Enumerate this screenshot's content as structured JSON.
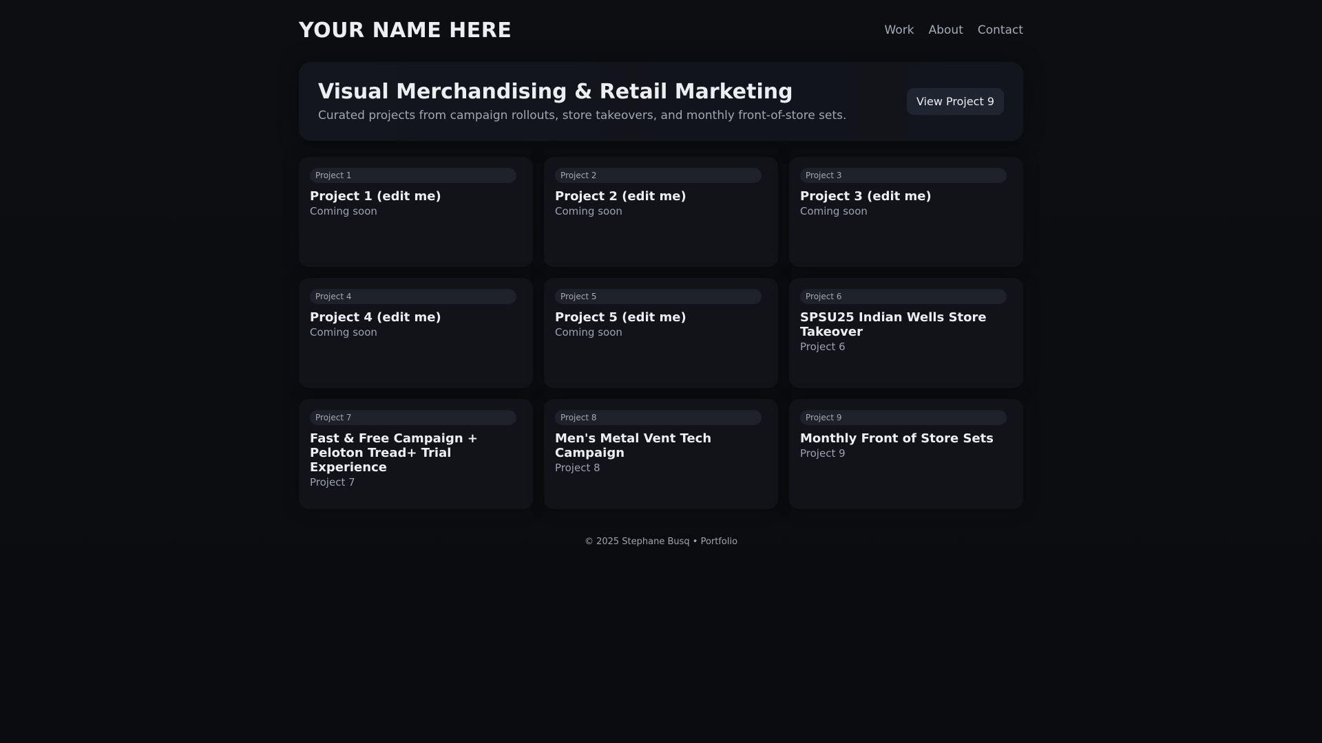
{
  "header": {
    "brand": "YOUR NAME HERE",
    "nav": [
      "Work",
      "About",
      "Contact"
    ]
  },
  "hero": {
    "title": "Visual Merchandising & Retail Marketing",
    "subtitle": "Curated projects from campaign rollouts, store takeovers, and monthly front-of-store sets.",
    "button_label": "View Project 9"
  },
  "projects": [
    {
      "tag": "Project 1",
      "title": "Project 1 (edit me)",
      "subtitle": "Coming soon"
    },
    {
      "tag": "Project 2",
      "title": "Project 2 (edit me)",
      "subtitle": "Coming soon"
    },
    {
      "tag": "Project 3",
      "title": "Project 3 (edit me)",
      "subtitle": "Coming soon"
    },
    {
      "tag": "Project 4",
      "title": "Project 4 (edit me)",
      "subtitle": "Coming soon"
    },
    {
      "tag": "Project 5",
      "title": "Project 5 (edit me)",
      "subtitle": "Coming soon"
    },
    {
      "tag": "Project 6",
      "title": "SPSU25 Indian Wells Store Takeover",
      "subtitle": "Project 6"
    },
    {
      "tag": "Project 7",
      "title": "Fast & Free Campaign + Peloton Tread+ Trial Experience",
      "subtitle": "Project 7"
    },
    {
      "tag": "Project 8",
      "title": "Men's Metal Vent Tech Campaign",
      "subtitle": "Project 8"
    },
    {
      "tag": "Project 9",
      "title": "Monthly Front of Store Sets",
      "subtitle": "Project 9"
    }
  ],
  "footer": {
    "text": "© 2025 Stephane Busq • Portfolio"
  }
}
